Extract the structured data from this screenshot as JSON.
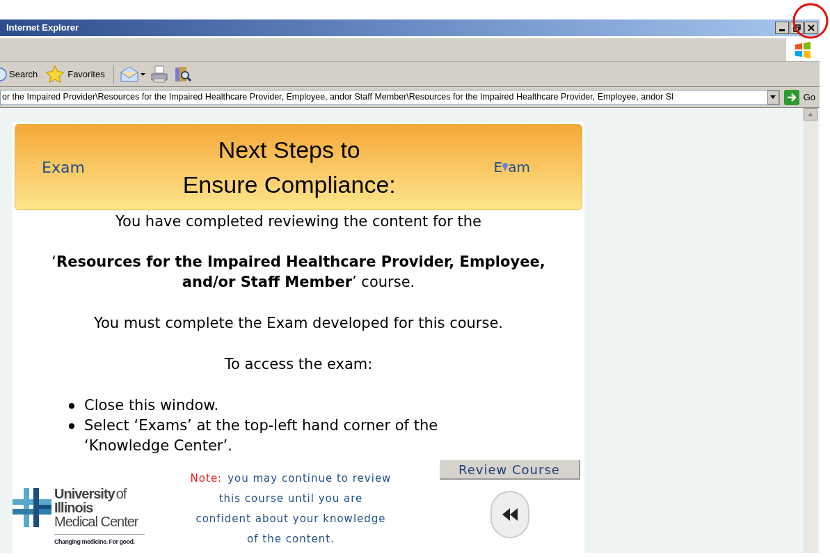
{
  "window": {
    "title": "Internet Explorer"
  },
  "toolbar": {
    "buttons": [
      {
        "label": "Search",
        "kind": "search"
      },
      {
        "label": "Favorites",
        "kind": "favorites"
      }
    ]
  },
  "address_bar": {
    "value": "or the Impaired Provider\\Resources for the Impaired Healthcare Provider, Employee, andor Staff Member\\Resources for the Impaired Healthcare Provider, Employee, andor Sl",
    "go": "Go"
  },
  "page": {
    "banner": {
      "left_label": "Exam",
      "right_label_start": "E",
      "right_label_end": "am",
      "title_lines": [
        "Next Steps to",
        "Ensure Compliance:"
      ]
    },
    "paragraphs": [
      "You have completed reviewing the content for the",
      "‘**Resources for the Impaired Healthcare Provider, Employee, and/or Staff Member**’ course.",
      "You must complete the Exam developed for this course.",
      "To access the exam:"
    ],
    "steps": [
      "Close this window.",
      "Select ‘Exams’ at the top-left hand corner of the ‘Knowledge Center’."
    ],
    "logo": {
      "lines": [
        "University",
        "of",
        "Illinois",
        "Medical Center"
      ],
      "tagline": "Changing medicine. For good."
    },
    "note": {
      "label": "Note:",
      "lines": [
        "you may continue to review",
        "this course until you are",
        "confident about your knowledge",
        "of the content."
      ]
    },
    "review_button": "Review Course"
  }
}
